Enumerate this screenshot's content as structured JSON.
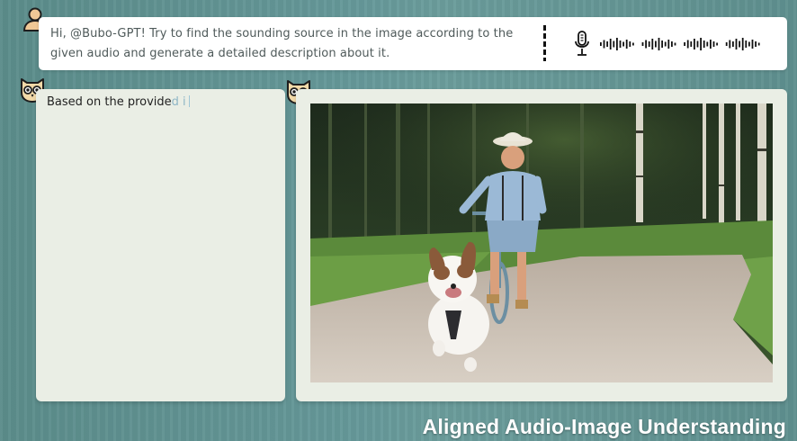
{
  "user_prompt": {
    "text": "Hi, @Bubo-GPT! Try to find the sounding source in the image according to the given audio and generate a detailed description about it."
  },
  "assistant_answer": {
    "text": "Based on the provide",
    "text_tail": "d i"
  },
  "caption": "Aligned Audio-Image Understanding",
  "icons": {
    "user": "user-avatar-icon",
    "assistant": "owl-avatar-icon",
    "microphone": "microphone-icon",
    "audio": "audio-waveform-icon"
  },
  "colors": {
    "background": "#62959",
    "panel": "#eaeee5",
    "prompt_text": "#4f5a5a",
    "owl": "#f2d9a8",
    "user_avatar": "#f0c896"
  }
}
